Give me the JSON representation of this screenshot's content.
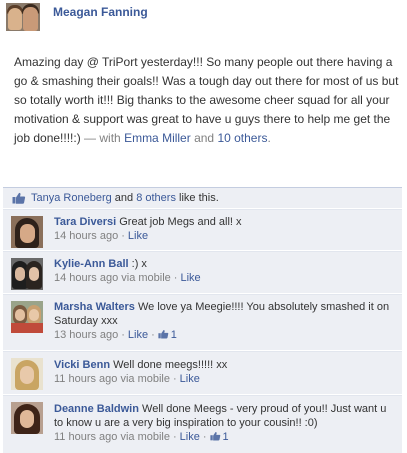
{
  "post": {
    "author": "Meagan Fanning",
    "text": "Amazing day @ TriPort yesterday!!! So many people out there having a go & smashing their goals!! Was a tough day out there for most of us but so totally worth it!!! Big thanks to the awesome cheer squad for all your motivation & support was great to have u guys there to help me get the job done!!!!:)",
    "with_prefix": " — with ",
    "tagged_person": "Emma Miller",
    "and_word": " and ",
    "tagged_others": "10 others",
    "end_punct": "."
  },
  "likes": {
    "name": "Tanya Roneberg",
    "and_word": " and ",
    "others": "8 others",
    "suffix": " like this."
  },
  "comments": [
    {
      "name": "Tara Diversi",
      "text": "Great job Megs and all! x",
      "time": "14 hours ago",
      "via": "",
      "like_label": "Like",
      "like_count": ""
    },
    {
      "name": "Kylie-Ann Ball",
      "text": ":) x",
      "time": "14 hours ago via mobile",
      "via": "",
      "like_label": "Like",
      "like_count": ""
    },
    {
      "name": "Marsha Walters",
      "text": "We love ya Meegie!!!! You absolutely smashed it on Saturday xxx",
      "time": "13 hours ago",
      "via": "",
      "like_label": "Like",
      "like_count": "1"
    },
    {
      "name": "Vicki Benn",
      "text": "Well done meegs!!!!! xx",
      "time": "11 hours ago via mobile",
      "via": "",
      "like_label": "Like",
      "like_count": ""
    },
    {
      "name": "Deanne Baldwin",
      "text": "Well done Meegs - very proud of you!! Just want u to know u are a very big inspiration to your cousin!! :0)",
      "time": "11 hours ago via mobile",
      "via": "",
      "like_label": "Like",
      "like_count": "1"
    }
  ],
  "colors": {
    "link": "#3b5998",
    "feedback_bg": "#edeff4",
    "meta": "#808080"
  },
  "icons": {
    "like": "thumbs-up-icon"
  }
}
